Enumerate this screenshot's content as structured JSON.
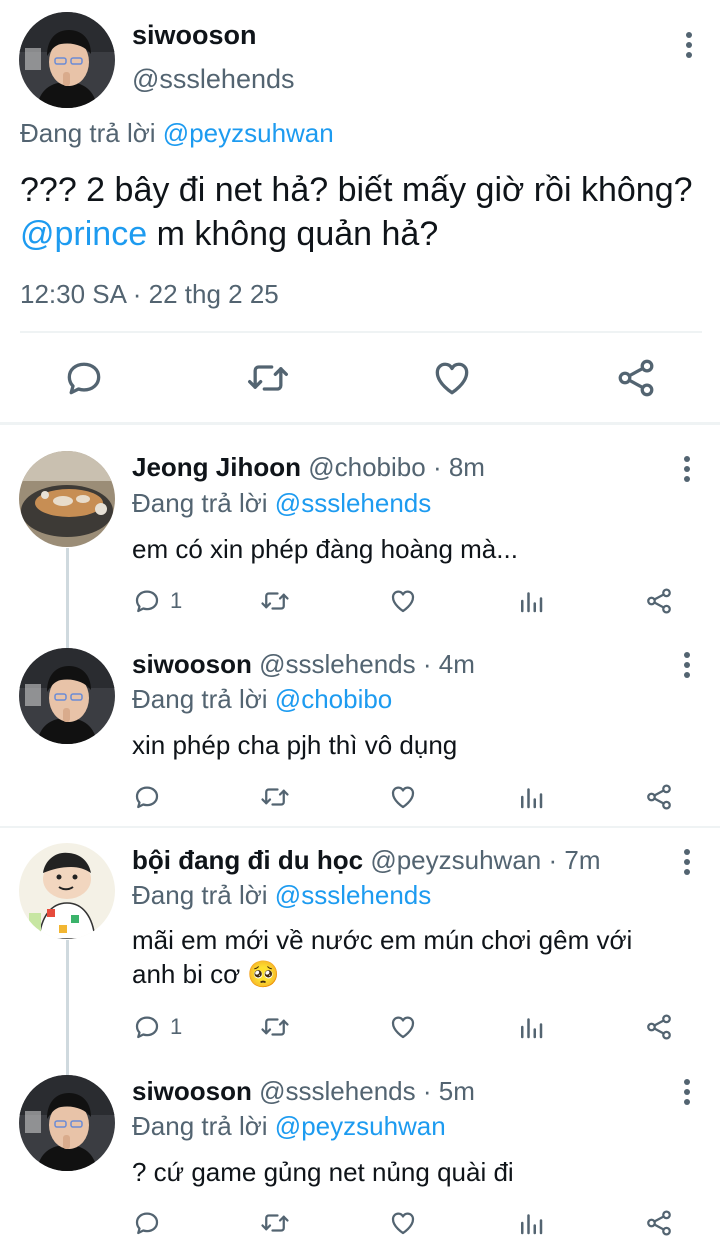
{
  "main_tweet": {
    "name": "siwooson",
    "handle": "@ssslehends",
    "replying_prefix": "Đang trả lời",
    "replying_to": "@peyzsuhwan",
    "text_part1": "??? 2 bây đi net hả? biết mấy giờ rồi không?",
    "mention": "@prince",
    "text_part2": "m không quản hả?",
    "timestamp": "12:30 SA · 22 thg 2 25"
  },
  "replies": [
    {
      "name": "Jeong Jihoon",
      "handle": "@chobibo",
      "time": "· 8m",
      "replying_prefix": "Đang trả lời",
      "replying_to": "@ssslehends",
      "text": "em có xin phép đàng hoàng mà...",
      "reply_count": "1"
    },
    {
      "name": "siwooson",
      "handle": "@ssslehends",
      "time": "· 4m",
      "replying_prefix": "Đang trả lời",
      "replying_to": "@chobibo",
      "text": "xin phép cha pjh thì vô dụng",
      "reply_count": ""
    },
    {
      "name": "bội đang đi du học",
      "handle": "@peyzsuhwan",
      "time": "· 7m",
      "replying_prefix": "Đang trả lời",
      "replying_to": "@ssslehends",
      "text": "mãi em mới về nước em mún chơi gêm với anh bi cơ 🥺",
      "reply_count": "1"
    },
    {
      "name": "siwooson",
      "handle": "@ssslehends",
      "time": "· 5m",
      "replying_prefix": "Đang trả lời",
      "replying_to": "@peyzsuhwan",
      "text": "? cứ game gủng net nủng quài đi",
      "reply_count": ""
    }
  ],
  "icons": [
    "comment-icon",
    "retweet-icon",
    "heart-icon",
    "share-icon",
    "views-icon",
    "more-icon"
  ],
  "colors": {
    "link": "#1d9bf0",
    "muted": "#536471",
    "text": "#0f1419",
    "divider": "#eff3f4"
  }
}
